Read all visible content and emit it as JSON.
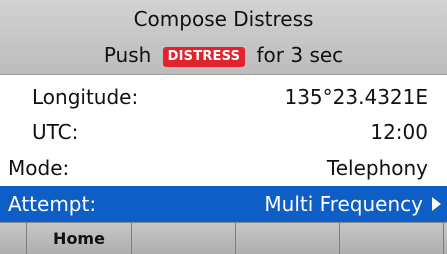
{
  "header": {
    "title": "Compose Distress",
    "instruction_prefix": "Push",
    "distress_key_label": "DISTRESS",
    "instruction_suffix": "for 3 sec"
  },
  "fields": {
    "longitude": {
      "label": "Longitude:",
      "value": "135°23.4321E"
    },
    "utc": {
      "label": "UTC:",
      "value": "12:00"
    },
    "mode": {
      "label": "Mode:",
      "value": "Telephony"
    },
    "attempt": {
      "label": "Attempt:",
      "value": "Multi Frequency"
    }
  },
  "softkeys": {
    "key1": "Home",
    "key2": "",
    "key3": "",
    "key4": ""
  },
  "colors": {
    "selection": "#0d5ec7",
    "distress_key": "#e2222c",
    "header_bg": "#c8c8c8"
  },
  "icons": {
    "attempt_arrow": "triangle-right-icon"
  }
}
